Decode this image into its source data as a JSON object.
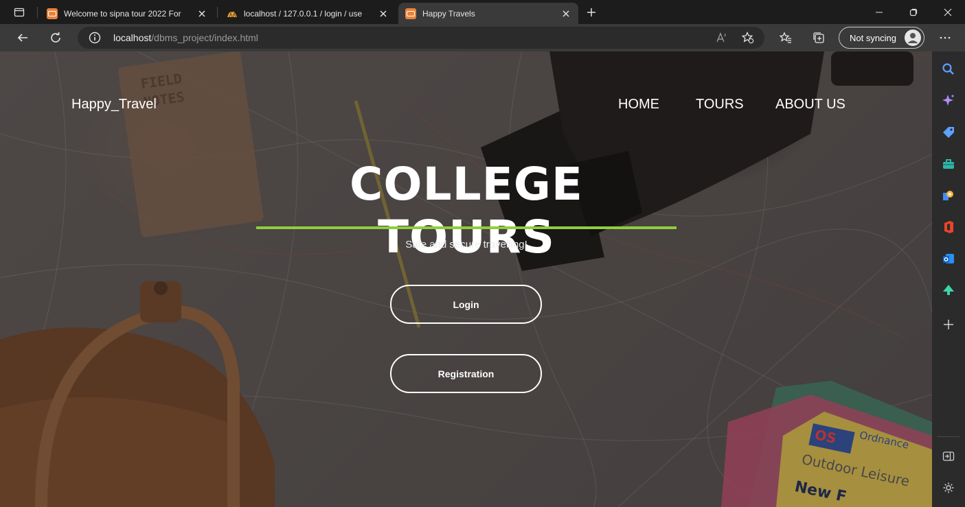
{
  "tabs": [
    {
      "title": "Welcome to sipna tour 2022 For",
      "active": false,
      "favicon": "page-orange-icon"
    },
    {
      "title": "localhost / 127.0.0.1 / login / use",
      "active": false,
      "favicon": "phpmyadmin-icon"
    },
    {
      "title": "Happy Travels",
      "active": true,
      "favicon": "page-orange-icon"
    }
  ],
  "address_bar": {
    "host": "localhost",
    "path": "/dbms_project/index.html"
  },
  "profile": {
    "sync_label": "Not syncing"
  },
  "page": {
    "brand": "Happy_Travel",
    "nav": [
      "HOME",
      "TOURS",
      "ABOUT US"
    ],
    "hero_title": "COLLEGE TOURS",
    "tagline": "Safe and secure travelling!",
    "buttons": {
      "login": "Login",
      "register": "Registration"
    },
    "accent_color": "#8fce3a"
  },
  "sidebar_icons": [
    "search-icon",
    "copilot-icon",
    "shopping-tag-icon",
    "tools-icon",
    "games-icon",
    "office-icon",
    "outlook-icon",
    "drop-icon",
    "add-icon",
    "hide-sidebar-icon",
    "settings-icon"
  ]
}
